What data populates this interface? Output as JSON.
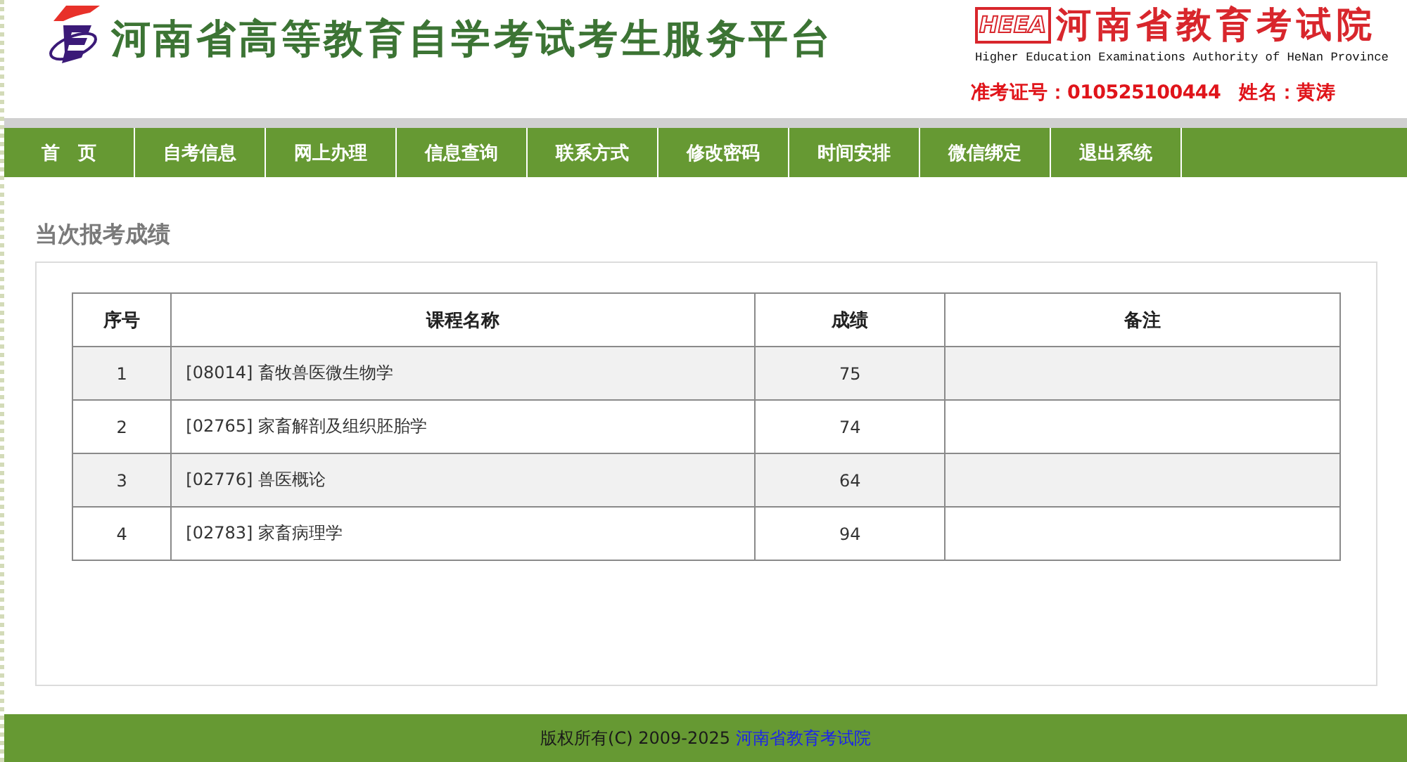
{
  "header": {
    "title": "河南省高等教育自学考试考生服务平台",
    "authority": {
      "mark": "HEEA",
      "name": "河南省教育考试院",
      "english": "Higher Education Examinations Authority of HeNan Province"
    },
    "candidate": [
      "准考证号：010525100444",
      "姓名：黄涛"
    ]
  },
  "nav": [
    "首　页",
    "自考信息",
    "网上办理",
    "信息查询",
    "联系方式",
    "修改密码",
    "时间安排",
    "微信绑定",
    "退出系统"
  ],
  "section": {
    "title": "当次报考成绩"
  },
  "table": {
    "columns": [
      "序号",
      "课程名称",
      "成绩",
      "备注"
    ],
    "rows": [
      {
        "index": "1",
        "course": "[08014] 畜牧兽医微生物学",
        "score": "75"
      },
      {
        "index": "2",
        "course": "[02765] 家畜解剖及组织胚胎学",
        "score": "74"
      },
      {
        "index": "3",
        "course": "[02776] 兽医概论",
        "score": "64"
      },
      {
        "index": "4",
        "course": "[02783] 家畜病理学",
        "score": "94"
      }
    ]
  },
  "footer": {
    "copyright": "版权所有(C) 2009-2025",
    "link": "河南省教育考试院"
  }
}
